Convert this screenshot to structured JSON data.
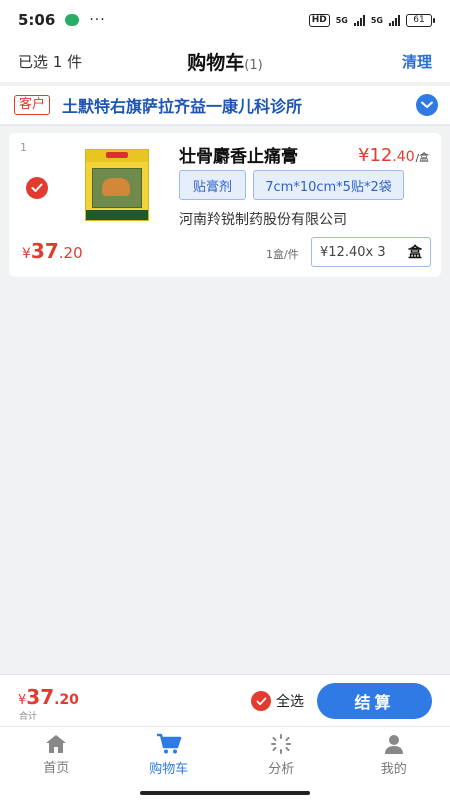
{
  "status_bar": {
    "time": "5:06",
    "dots": "···",
    "hd_label": "HD",
    "net1": "5G",
    "net2": "5G",
    "battery": "61"
  },
  "header": {
    "selected_text": "已选 1 件",
    "title": "购物车",
    "count": "(1)",
    "clear_label": "清理"
  },
  "customer": {
    "tag": "客户",
    "name": "土默特右旗萨拉齐益一康儿科诊所"
  },
  "cart_item": {
    "index": "1",
    "name": "壮骨麝香止痛膏",
    "price_yen": "¥",
    "price_int": "12",
    "price_cents": ".40",
    "price_unit": "/盒",
    "form_tag": "贴膏剂",
    "spec_tag": "7cm*10cm*5贴*2袋",
    "manufacturer": "河南羚锐制药股份有限公司",
    "subtotal_yen": "¥",
    "subtotal_int": "37",
    "subtotal_cents": ".20",
    "pack_info": "1盒/件",
    "qty_text": "¥12.40x 3",
    "qty_unit": "盒",
    "selected": true
  },
  "footer": {
    "total_yen": "¥",
    "total_int": "37",
    "total_cents": ".20",
    "total_label": "合计",
    "select_all_label": "全选",
    "checkout_label": "结算"
  },
  "tabs": [
    {
      "label": "首页",
      "icon": "home-icon",
      "active": false
    },
    {
      "label": "购物车",
      "icon": "cart-icon",
      "active": true
    },
    {
      "label": "分析",
      "icon": "analysis-icon",
      "active": false
    },
    {
      "label": "我的",
      "icon": "profile-icon",
      "active": false
    }
  ],
  "colors": {
    "accent": "#2f7ae5",
    "price_red": "#e23b30",
    "customer_blue": "#1f56b3"
  }
}
